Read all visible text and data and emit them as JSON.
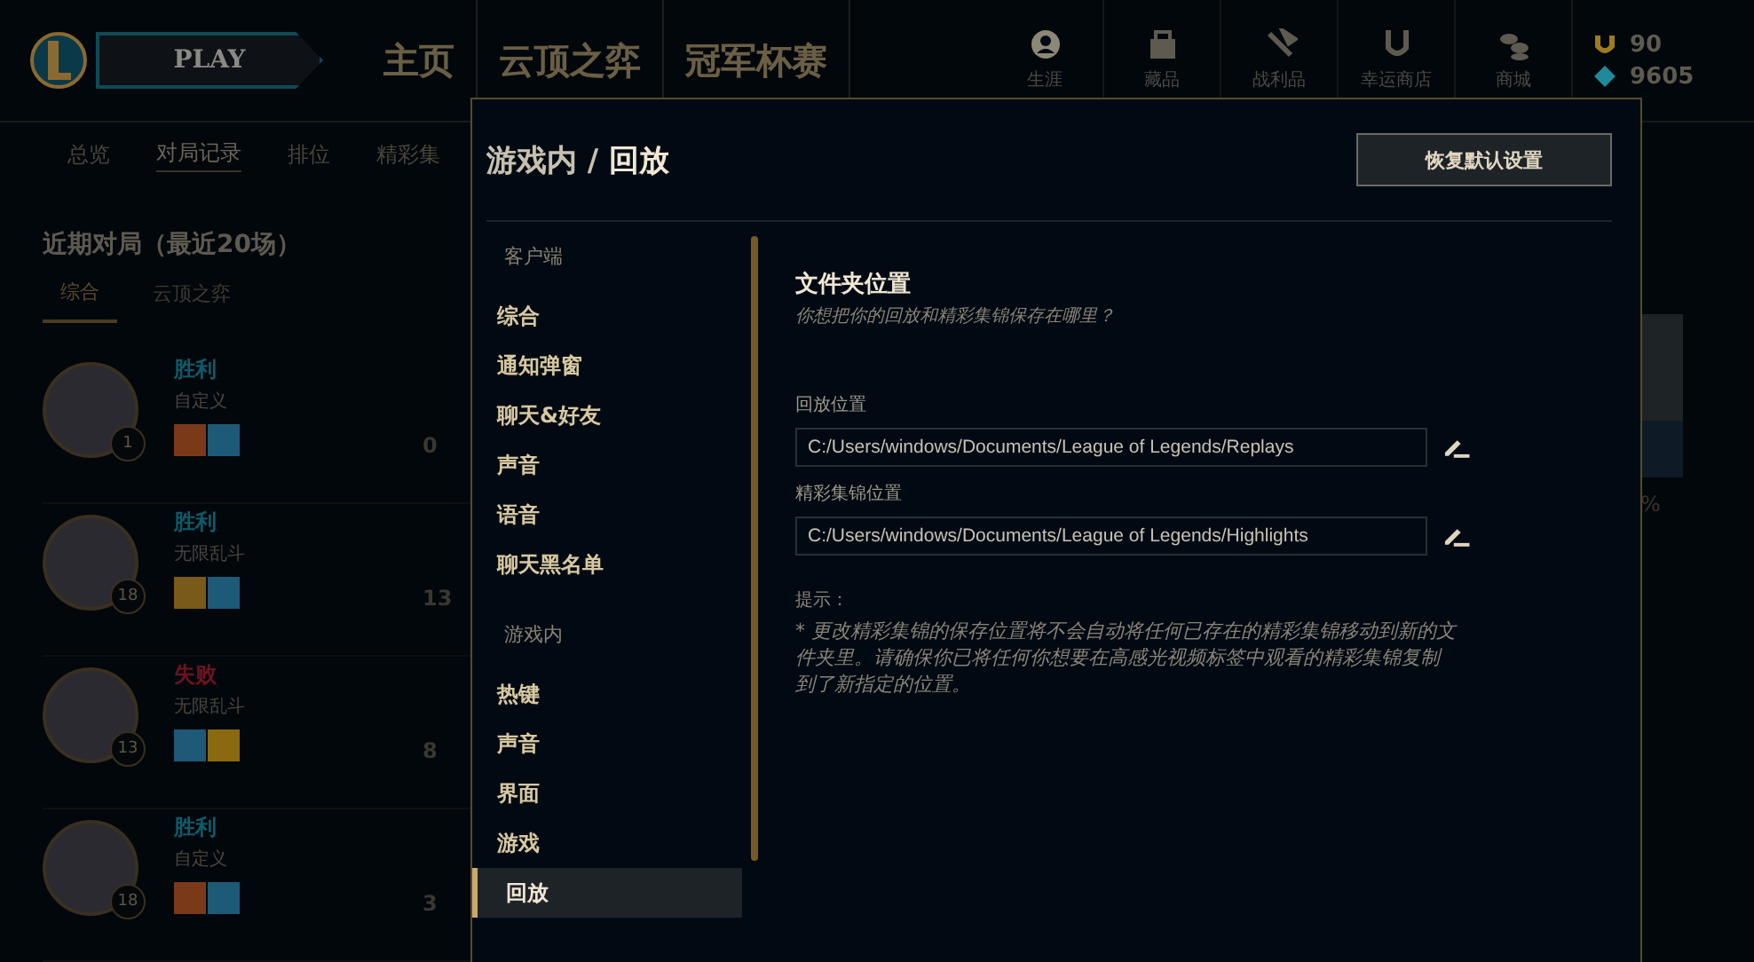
{
  "nav": {
    "play": "PLAY",
    "tabs": [
      {
        "label": "主页",
        "selected": false
      },
      {
        "label": "云顶之弈",
        "selected": false
      },
      {
        "label": "冠军杯赛",
        "selected": false
      }
    ],
    "icons": [
      {
        "kind": "profile",
        "label": "生涯",
        "selected": true
      },
      {
        "kind": "collection",
        "label": "藏品",
        "selected": false
      },
      {
        "kind": "loot",
        "label": "战利品",
        "selected": false
      },
      {
        "kind": "shop",
        "label": "幸运商店",
        "selected": false
      },
      {
        "kind": "store",
        "label": "商城",
        "selected": false
      }
    ],
    "currency": [
      {
        "kind": "rp",
        "value": "90"
      },
      {
        "kind": "be",
        "value": "9605"
      }
    ]
  },
  "subnav": [
    {
      "label": "总览",
      "selected": false
    },
    {
      "label": "对局记录",
      "selected": true
    },
    {
      "label": "排位",
      "selected": false
    },
    {
      "label": "精彩集",
      "selected": false
    }
  ],
  "matches": {
    "title": "近期对局（最近20场）",
    "tabs": [
      {
        "label": "综合",
        "selected": true
      },
      {
        "label": "云顶之弈",
        "selected": false
      }
    ],
    "rows": [
      {
        "result": "胜利",
        "win": true,
        "mode": "自定义",
        "level": "1",
        "score": "0",
        "spells": [
          {
            "color": "#7a3a1a"
          },
          {
            "color": "#1e5a78"
          }
        ]
      },
      {
        "result": "胜利",
        "win": true,
        "mode": "无限乱斗",
        "level": "18",
        "score": "13",
        "spells": [
          {
            "color": "#7a5a1a"
          },
          {
            "color": "#1e5a78"
          }
        ]
      },
      {
        "result": "失败",
        "win": false,
        "mode": "无限乱斗",
        "level": "13",
        "score": "8",
        "spells": [
          {
            "color": "#1e5a78"
          },
          {
            "color": "#8a6a10"
          }
        ]
      },
      {
        "result": "胜利",
        "win": true,
        "mode": "自定义",
        "level": "18",
        "score": "3",
        "spells": [
          {
            "color": "#7a3a1a"
          },
          {
            "color": "#1e5a78"
          }
        ]
      }
    ]
  },
  "side_text": "%",
  "settings": {
    "breadcrumb": "游戏内 / **回放**",
    "reset_button": "恢复默认设置",
    "sections": [
      {
        "heading": "客户端",
        "items": [
          {
            "label": "综合",
            "selected": false
          },
          {
            "label": "通知弹窗",
            "selected": false
          },
          {
            "label": "聊天&好友",
            "selected": false
          },
          {
            "label": "声音",
            "selected": false
          },
          {
            "label": "语音",
            "selected": false
          },
          {
            "label": "聊天黑名单",
            "selected": false
          }
        ]
      },
      {
        "heading": "游戏内",
        "items": [
          {
            "label": "热键",
            "selected": false
          },
          {
            "label": "声音",
            "selected": false
          },
          {
            "label": "界面",
            "selected": false
          },
          {
            "label": "游戏",
            "selected": false
          },
          {
            "label": "回放",
            "selected": true
          }
        ]
      }
    ],
    "content": {
      "title": "文件夹位置",
      "subtitle": "你想把你的回放和精彩集锦保存在哪里？",
      "fields": [
        {
          "label": "回放位置",
          "value": "C:/Users/windows/Documents/League of Legends/Replays"
        },
        {
          "label": "精彩集锦位置",
          "value": "C:/Users/windows/Documents/League of Legends/Highlights"
        }
      ],
      "tip_label": "提示：",
      "tip": "* 更改精彩集锦的保存位置将不会自动将任何已存在的精彩集锦移动到新的文件夹里。请确保你已将任何你想要在高感光视频标签中观看的精彩集锦复制到了新指定的位置。"
    }
  }
}
